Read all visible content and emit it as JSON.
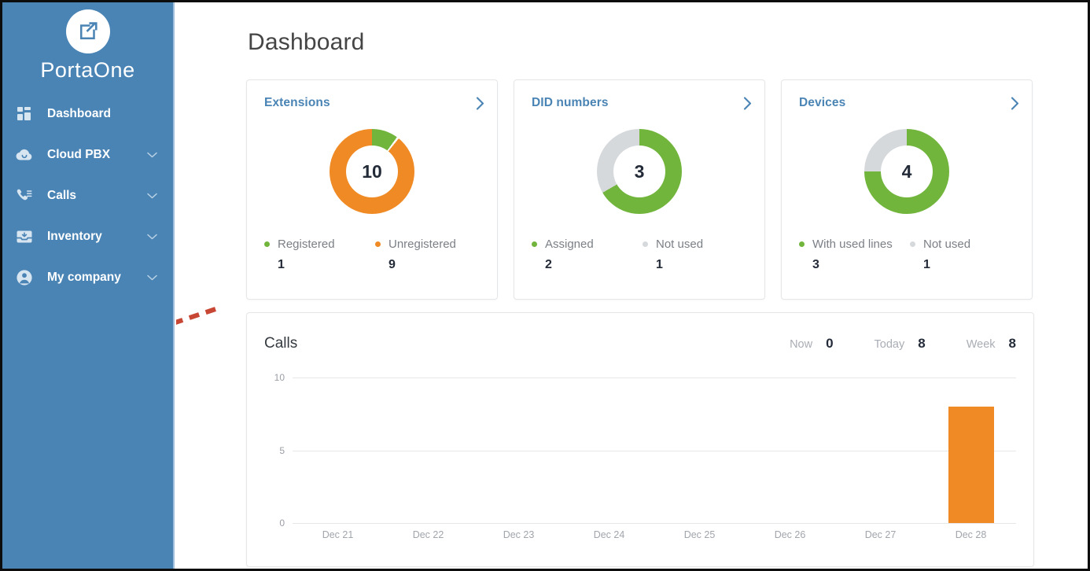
{
  "sidebar": {
    "brand_name": "PortaOne",
    "logo_icon": "open-in-new-square-icon",
    "items": [
      {
        "label": "Dashboard",
        "icon": "dashboard-grid-icon",
        "expandable": false
      },
      {
        "label": "Cloud PBX",
        "icon": "cloud-pbx-icon",
        "expandable": true
      },
      {
        "label": "Calls",
        "icon": "phone-list-icon",
        "expandable": true
      },
      {
        "label": "Inventory",
        "icon": "inbox-tray-icon",
        "expandable": true
      },
      {
        "label": "My company",
        "icon": "user-circle-icon",
        "expandable": true
      }
    ],
    "chevron_icon": "chevron-down-icon",
    "background_color": "#4a84b5"
  },
  "header": {
    "title": "Dashboard"
  },
  "colors": {
    "green": "#72b53d",
    "orange": "#f08a24",
    "gray": "#d6d9dc",
    "link_blue": "#4a84b5",
    "sidebar_blue": "#4a84b5",
    "annotation_red": "#c74634"
  },
  "cards": [
    {
      "id": "extensions",
      "title": "Extensions",
      "chevron_icon": "chevron-right-icon",
      "total": "10",
      "legend": [
        {
          "label": "Registered",
          "value": "1",
          "color": "#72b53d"
        },
        {
          "label": "Unregistered",
          "value": "9",
          "color": "#f08a24"
        }
      ]
    },
    {
      "id": "dids",
      "title": "DID numbers",
      "chevron_icon": "chevron-right-icon",
      "total": "3",
      "legend": [
        {
          "label": "Assigned",
          "value": "2",
          "color": "#72b53d"
        },
        {
          "label": "Not used",
          "value": "1",
          "color": "#d6d9dc"
        }
      ]
    },
    {
      "id": "devices",
      "title": "Devices",
      "chevron_icon": "chevron-right-icon",
      "total": "4",
      "legend": [
        {
          "label": "With used lines",
          "value": "3",
          "color": "#72b53d"
        },
        {
          "label": "Not used",
          "value": "1",
          "color": "#d6d9dc"
        }
      ]
    }
  ],
  "calls": {
    "title": "Calls",
    "stats": [
      {
        "label": "Now",
        "value": "0"
      },
      {
        "label": "Today",
        "value": "8"
      },
      {
        "label": "Week",
        "value": "8"
      }
    ]
  },
  "annotation": {
    "type": "dashed-arrow",
    "color": "#c74634",
    "direction": "left-down"
  },
  "chart_data": [
    {
      "type": "pie",
      "title": "Extensions",
      "center_label": "10",
      "labels": [
        "Registered",
        "Unregistered"
      ],
      "values": [
        1,
        9
      ],
      "colors": [
        "#72b53d",
        "#f08a24"
      ],
      "legend": "bottom"
    },
    {
      "type": "pie",
      "title": "DID numbers",
      "center_label": "3",
      "labels": [
        "Assigned",
        "Not used"
      ],
      "values": [
        2,
        1
      ],
      "colors": [
        "#72b53d",
        "#d6d9dc"
      ],
      "legend": "bottom"
    },
    {
      "type": "pie",
      "title": "Devices",
      "center_label": "4",
      "labels": [
        "With used lines",
        "Not used"
      ],
      "values": [
        3,
        1
      ],
      "colors": [
        "#72b53d",
        "#d6d9dc"
      ],
      "legend": "bottom"
    },
    {
      "type": "bar",
      "title": "Calls",
      "categories": [
        "Dec 21",
        "Dec 22",
        "Dec 23",
        "Dec 24",
        "Dec 25",
        "Dec 26",
        "Dec 27",
        "Dec 28"
      ],
      "values": [
        0,
        0,
        0,
        0,
        0,
        0,
        0,
        8
      ],
      "yticks": [
        0,
        5,
        10
      ],
      "ylim": [
        0,
        10
      ],
      "xlabel": "",
      "ylabel": "",
      "grid": true,
      "bar_color": "#f08a24",
      "legend": "none"
    }
  ]
}
